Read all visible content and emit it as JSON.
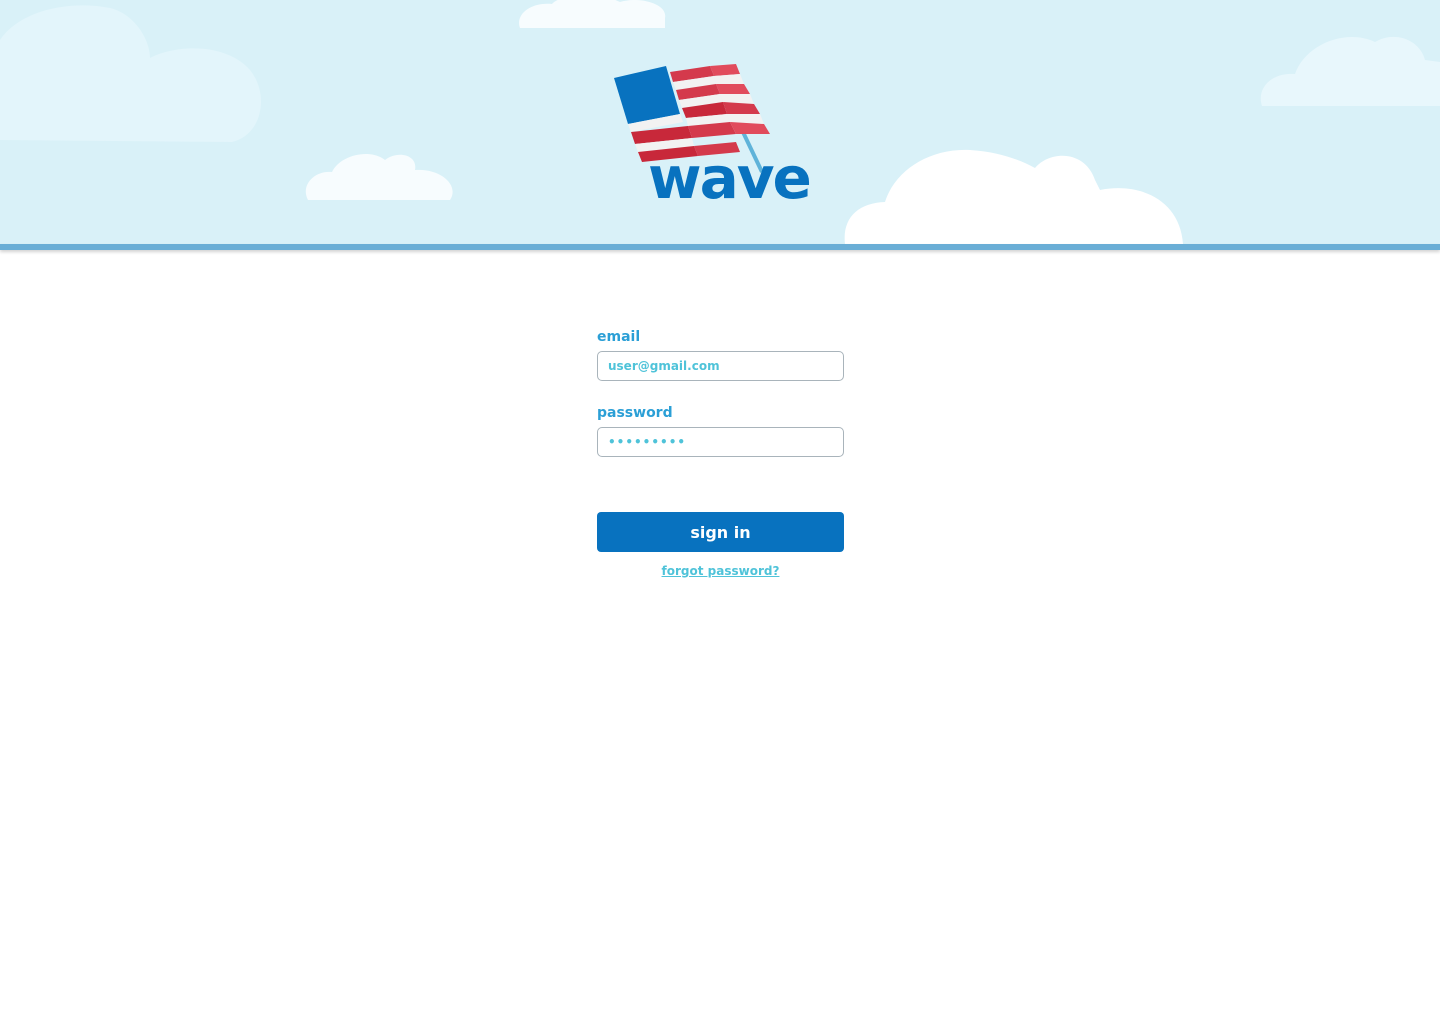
{
  "brand": {
    "name": "wave",
    "colors": {
      "sky": "#d9f1f8",
      "cloud": "#ffffff",
      "primary_blue": "#0872bf",
      "label_blue": "#2b9fd6",
      "accent_teal": "#4fc3d9",
      "flag_red": "#c8283a",
      "flag_white": "#f2f2f2"
    }
  },
  "login_form": {
    "email": {
      "label": "email",
      "value": "",
      "placeholder": "user@gmail.com"
    },
    "password": {
      "label": "password",
      "value": "•••••••••",
      "placeholder": ""
    },
    "submit_label": "sign in",
    "forgot_label": "forgot password?"
  }
}
